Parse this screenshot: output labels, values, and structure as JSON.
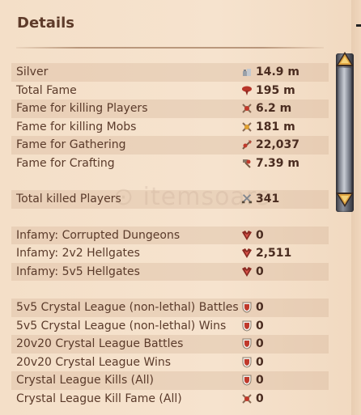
{
  "header": {
    "title": "Details"
  },
  "colors": {
    "background": "#f2dcc4",
    "text": "#5a3a2a",
    "accent": "#b23a2a"
  },
  "groups": [
    {
      "rows": [
        {
          "label": "Silver",
          "icon": "silver-coin-icon",
          "value": "14.9 m"
        },
        {
          "label": "Total Fame",
          "icon": "fame-banner-icon",
          "value": "195 m"
        },
        {
          "label": "Fame for killing Players",
          "icon": "pvp-fame-icon",
          "value": "6.2 m"
        },
        {
          "label": "Fame for killing Mobs",
          "icon": "pve-fame-icon",
          "value": "181 m"
        },
        {
          "label": "Fame for Gathering",
          "icon": "gathering-fame-icon",
          "value": "22,037"
        },
        {
          "label": "Fame for Crafting",
          "icon": "crafting-fame-icon",
          "value": "7.39 m"
        }
      ]
    },
    {
      "rows": [
        {
          "label": "Total killed Players",
          "icon": "crossed-swords-icon",
          "value": "341"
        }
      ]
    },
    {
      "rows": [
        {
          "label": "Infamy: Corrupted Dungeons",
          "icon": "infamy-icon",
          "value": "0"
        },
        {
          "label": "Infamy: 2v2 Hellgates",
          "icon": "infamy-icon",
          "value": "2,511"
        },
        {
          "label": "Infamy: 5v5 Hellgates",
          "icon": "infamy-icon",
          "value": "0"
        }
      ]
    },
    {
      "rows": [
        {
          "label": "5v5 Crystal League (non-lethal) Battles",
          "icon": "crystal-shield-icon",
          "value": "0"
        },
        {
          "label": "5v5 Crystal League (non-lethal) Wins",
          "icon": "crystal-shield-icon",
          "value": "0"
        },
        {
          "label": "20v20 Crystal League Battles",
          "icon": "crystal-shield-icon",
          "value": "0"
        },
        {
          "label": "20v20 Crystal League Wins",
          "icon": "crystal-shield-icon",
          "value": "0"
        },
        {
          "label": "Crystal League Kills (All)",
          "icon": "crystal-shield-icon",
          "value": "0"
        },
        {
          "label": "Crystal League Kill Fame (All)",
          "icon": "pvp-fame-icon",
          "value": "0"
        }
      ]
    }
  ]
}
